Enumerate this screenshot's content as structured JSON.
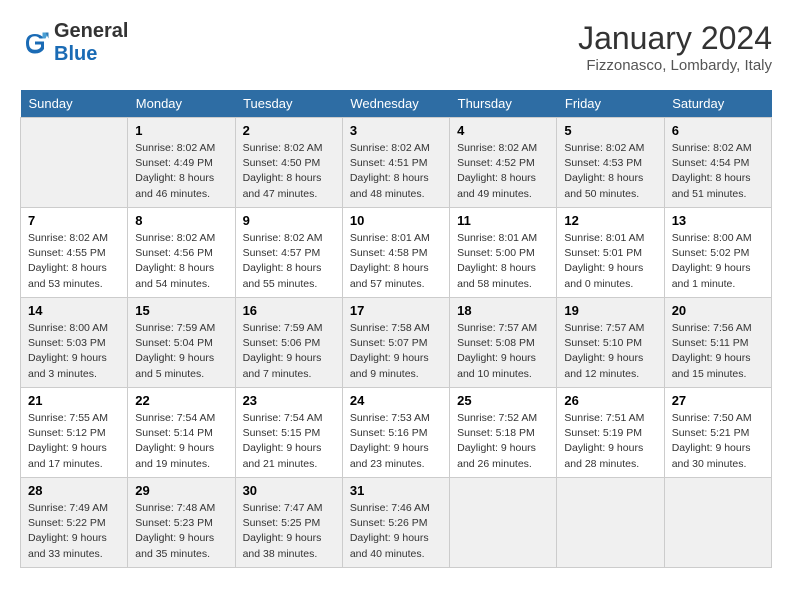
{
  "header": {
    "logo_line1": "General",
    "logo_line2": "Blue",
    "title": "January 2024",
    "location": "Fizzonasco, Lombardy, Italy"
  },
  "weekdays": [
    "Sunday",
    "Monday",
    "Tuesday",
    "Wednesday",
    "Thursday",
    "Friday",
    "Saturday"
  ],
  "weeks": [
    [
      {
        "day": "",
        "sunrise": "",
        "sunset": "",
        "daylight": ""
      },
      {
        "day": "1",
        "sunrise": "Sunrise: 8:02 AM",
        "sunset": "Sunset: 4:49 PM",
        "daylight": "Daylight: 8 hours and 46 minutes."
      },
      {
        "day": "2",
        "sunrise": "Sunrise: 8:02 AM",
        "sunset": "Sunset: 4:50 PM",
        "daylight": "Daylight: 8 hours and 47 minutes."
      },
      {
        "day": "3",
        "sunrise": "Sunrise: 8:02 AM",
        "sunset": "Sunset: 4:51 PM",
        "daylight": "Daylight: 8 hours and 48 minutes."
      },
      {
        "day": "4",
        "sunrise": "Sunrise: 8:02 AM",
        "sunset": "Sunset: 4:52 PM",
        "daylight": "Daylight: 8 hours and 49 minutes."
      },
      {
        "day": "5",
        "sunrise": "Sunrise: 8:02 AM",
        "sunset": "Sunset: 4:53 PM",
        "daylight": "Daylight: 8 hours and 50 minutes."
      },
      {
        "day": "6",
        "sunrise": "Sunrise: 8:02 AM",
        "sunset": "Sunset: 4:54 PM",
        "daylight": "Daylight: 8 hours and 51 minutes."
      }
    ],
    [
      {
        "day": "7",
        "sunrise": "Sunrise: 8:02 AM",
        "sunset": "Sunset: 4:55 PM",
        "daylight": "Daylight: 8 hours and 53 minutes."
      },
      {
        "day": "8",
        "sunrise": "Sunrise: 8:02 AM",
        "sunset": "Sunset: 4:56 PM",
        "daylight": "Daylight: 8 hours and 54 minutes."
      },
      {
        "day": "9",
        "sunrise": "Sunrise: 8:02 AM",
        "sunset": "Sunset: 4:57 PM",
        "daylight": "Daylight: 8 hours and 55 minutes."
      },
      {
        "day": "10",
        "sunrise": "Sunrise: 8:01 AM",
        "sunset": "Sunset: 4:58 PM",
        "daylight": "Daylight: 8 hours and 57 minutes."
      },
      {
        "day": "11",
        "sunrise": "Sunrise: 8:01 AM",
        "sunset": "Sunset: 5:00 PM",
        "daylight": "Daylight: 8 hours and 58 minutes."
      },
      {
        "day": "12",
        "sunrise": "Sunrise: 8:01 AM",
        "sunset": "Sunset: 5:01 PM",
        "daylight": "Daylight: 9 hours and 0 minutes."
      },
      {
        "day": "13",
        "sunrise": "Sunrise: 8:00 AM",
        "sunset": "Sunset: 5:02 PM",
        "daylight": "Daylight: 9 hours and 1 minute."
      }
    ],
    [
      {
        "day": "14",
        "sunrise": "Sunrise: 8:00 AM",
        "sunset": "Sunset: 5:03 PM",
        "daylight": "Daylight: 9 hours and 3 minutes."
      },
      {
        "day": "15",
        "sunrise": "Sunrise: 7:59 AM",
        "sunset": "Sunset: 5:04 PM",
        "daylight": "Daylight: 9 hours and 5 minutes."
      },
      {
        "day": "16",
        "sunrise": "Sunrise: 7:59 AM",
        "sunset": "Sunset: 5:06 PM",
        "daylight": "Daylight: 9 hours and 7 minutes."
      },
      {
        "day": "17",
        "sunrise": "Sunrise: 7:58 AM",
        "sunset": "Sunset: 5:07 PM",
        "daylight": "Daylight: 9 hours and 9 minutes."
      },
      {
        "day": "18",
        "sunrise": "Sunrise: 7:57 AM",
        "sunset": "Sunset: 5:08 PM",
        "daylight": "Daylight: 9 hours and 10 minutes."
      },
      {
        "day": "19",
        "sunrise": "Sunrise: 7:57 AM",
        "sunset": "Sunset: 5:10 PM",
        "daylight": "Daylight: 9 hours and 12 minutes."
      },
      {
        "day": "20",
        "sunrise": "Sunrise: 7:56 AM",
        "sunset": "Sunset: 5:11 PM",
        "daylight": "Daylight: 9 hours and 15 minutes."
      }
    ],
    [
      {
        "day": "21",
        "sunrise": "Sunrise: 7:55 AM",
        "sunset": "Sunset: 5:12 PM",
        "daylight": "Daylight: 9 hours and 17 minutes."
      },
      {
        "day": "22",
        "sunrise": "Sunrise: 7:54 AM",
        "sunset": "Sunset: 5:14 PM",
        "daylight": "Daylight: 9 hours and 19 minutes."
      },
      {
        "day": "23",
        "sunrise": "Sunrise: 7:54 AM",
        "sunset": "Sunset: 5:15 PM",
        "daylight": "Daylight: 9 hours and 21 minutes."
      },
      {
        "day": "24",
        "sunrise": "Sunrise: 7:53 AM",
        "sunset": "Sunset: 5:16 PM",
        "daylight": "Daylight: 9 hours and 23 minutes."
      },
      {
        "day": "25",
        "sunrise": "Sunrise: 7:52 AM",
        "sunset": "Sunset: 5:18 PM",
        "daylight": "Daylight: 9 hours and 26 minutes."
      },
      {
        "day": "26",
        "sunrise": "Sunrise: 7:51 AM",
        "sunset": "Sunset: 5:19 PM",
        "daylight": "Daylight: 9 hours and 28 minutes."
      },
      {
        "day": "27",
        "sunrise": "Sunrise: 7:50 AM",
        "sunset": "Sunset: 5:21 PM",
        "daylight": "Daylight: 9 hours and 30 minutes."
      }
    ],
    [
      {
        "day": "28",
        "sunrise": "Sunrise: 7:49 AM",
        "sunset": "Sunset: 5:22 PM",
        "daylight": "Daylight: 9 hours and 33 minutes."
      },
      {
        "day": "29",
        "sunrise": "Sunrise: 7:48 AM",
        "sunset": "Sunset: 5:23 PM",
        "daylight": "Daylight: 9 hours and 35 minutes."
      },
      {
        "day": "30",
        "sunrise": "Sunrise: 7:47 AM",
        "sunset": "Sunset: 5:25 PM",
        "daylight": "Daylight: 9 hours and 38 minutes."
      },
      {
        "day": "31",
        "sunrise": "Sunrise: 7:46 AM",
        "sunset": "Sunset: 5:26 PM",
        "daylight": "Daylight: 9 hours and 40 minutes."
      },
      {
        "day": "",
        "sunrise": "",
        "sunset": "",
        "daylight": ""
      },
      {
        "day": "",
        "sunrise": "",
        "sunset": "",
        "daylight": ""
      },
      {
        "day": "",
        "sunrise": "",
        "sunset": "",
        "daylight": ""
      }
    ]
  ]
}
